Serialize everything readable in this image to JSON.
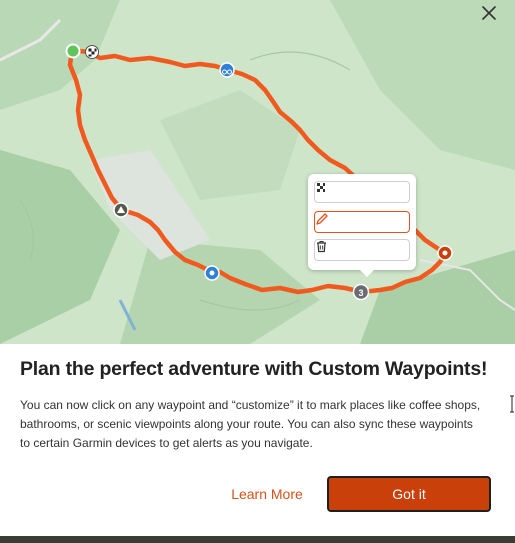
{
  "dialog": {
    "title": "Plan the perfect adventure with Custom Waypoints!",
    "description": "You can now click on any waypoint and “customize” it to mark places like coffee shops, bathrooms, or scenic viewpoints along your route. You can also sync these waypoints to certain Garmin devices to get alerts as you navigate.",
    "learn_more_label": "Learn More",
    "got_it_label": "Got it",
    "close_icon": "close-icon"
  },
  "map": {
    "route_color": "#f05a1e",
    "waypoint_marker_label": "3",
    "waypoint_icons": [
      "start-icon",
      "finish-flag-icon",
      "bike-icon",
      "campsite-icon",
      "viewpoint-icon",
      "waypoint-number-icon",
      "end-marker-icon"
    ],
    "popup_actions": [
      {
        "name": "finish-flag-icon"
      },
      {
        "name": "edit-pencil-icon"
      },
      {
        "name": "trash-icon"
      }
    ]
  },
  "colors": {
    "accent": "#c9400a",
    "link": "#d2521c",
    "map_green": "#cde3c8"
  }
}
